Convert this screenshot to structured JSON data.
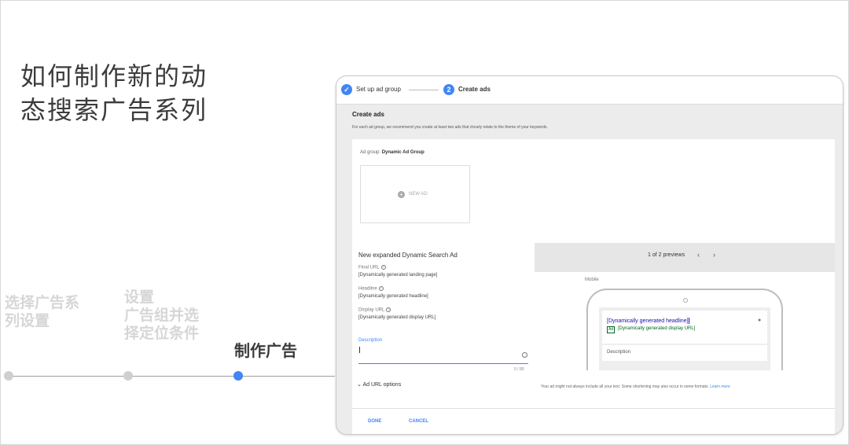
{
  "slide": {
    "title_line1": "如何制作新的动",
    "title_line2": "态搜索广告系列",
    "steps": [
      {
        "line1": "选择广告系",
        "line2": "列设置"
      },
      {
        "line1": "设置",
        "line2": "广告组并选",
        "line3": "择定位条件"
      },
      {
        "line1": "制作广告"
      }
    ],
    "active_step_color": "#4285f4"
  },
  "screenshot": {
    "stepper": {
      "step1_label": "Set up ad group",
      "step1_icon": "check-icon",
      "step2_number": "2",
      "step2_label": "Create ads"
    },
    "create": {
      "title": "Create ads",
      "subtitle": "For each ad group, we recommend you create at least two ads that closely relate to the theme of your keywords."
    },
    "ad_group": {
      "label_prefix": "Ad group:",
      "name": "Dynamic Ad Group",
      "new_ad_label": "NEW AD"
    },
    "form": {
      "title": "New expanded Dynamic Search Ad",
      "final_url_label": "Final URL",
      "final_url_value": "[Dynamically generated landing page]",
      "headline_label": "Headline",
      "headline_value": "[Dynamically generated headline]",
      "display_url_label": "Display URL",
      "display_url_value": "[Dynamically generated display URL]",
      "description_label": "Description",
      "description_count": "0 / 80",
      "ad_url_options": "Ad URL options"
    },
    "preview": {
      "count": "1 of 2 previews",
      "prev_arrow": "‹",
      "next_arrow": "›",
      "mobile_label": "Mobile",
      "headline": "[Dynamically generated headline]",
      "ad_badge": "Ad",
      "display_url": "[Dynamically generated display URL]",
      "description": "Description",
      "note": "Your ad might not always include all your text. Some shortening may also occur in some formats.",
      "learn_more": "Learn more"
    },
    "footer": {
      "done": "DONE",
      "cancel": "CANCEL"
    }
  }
}
